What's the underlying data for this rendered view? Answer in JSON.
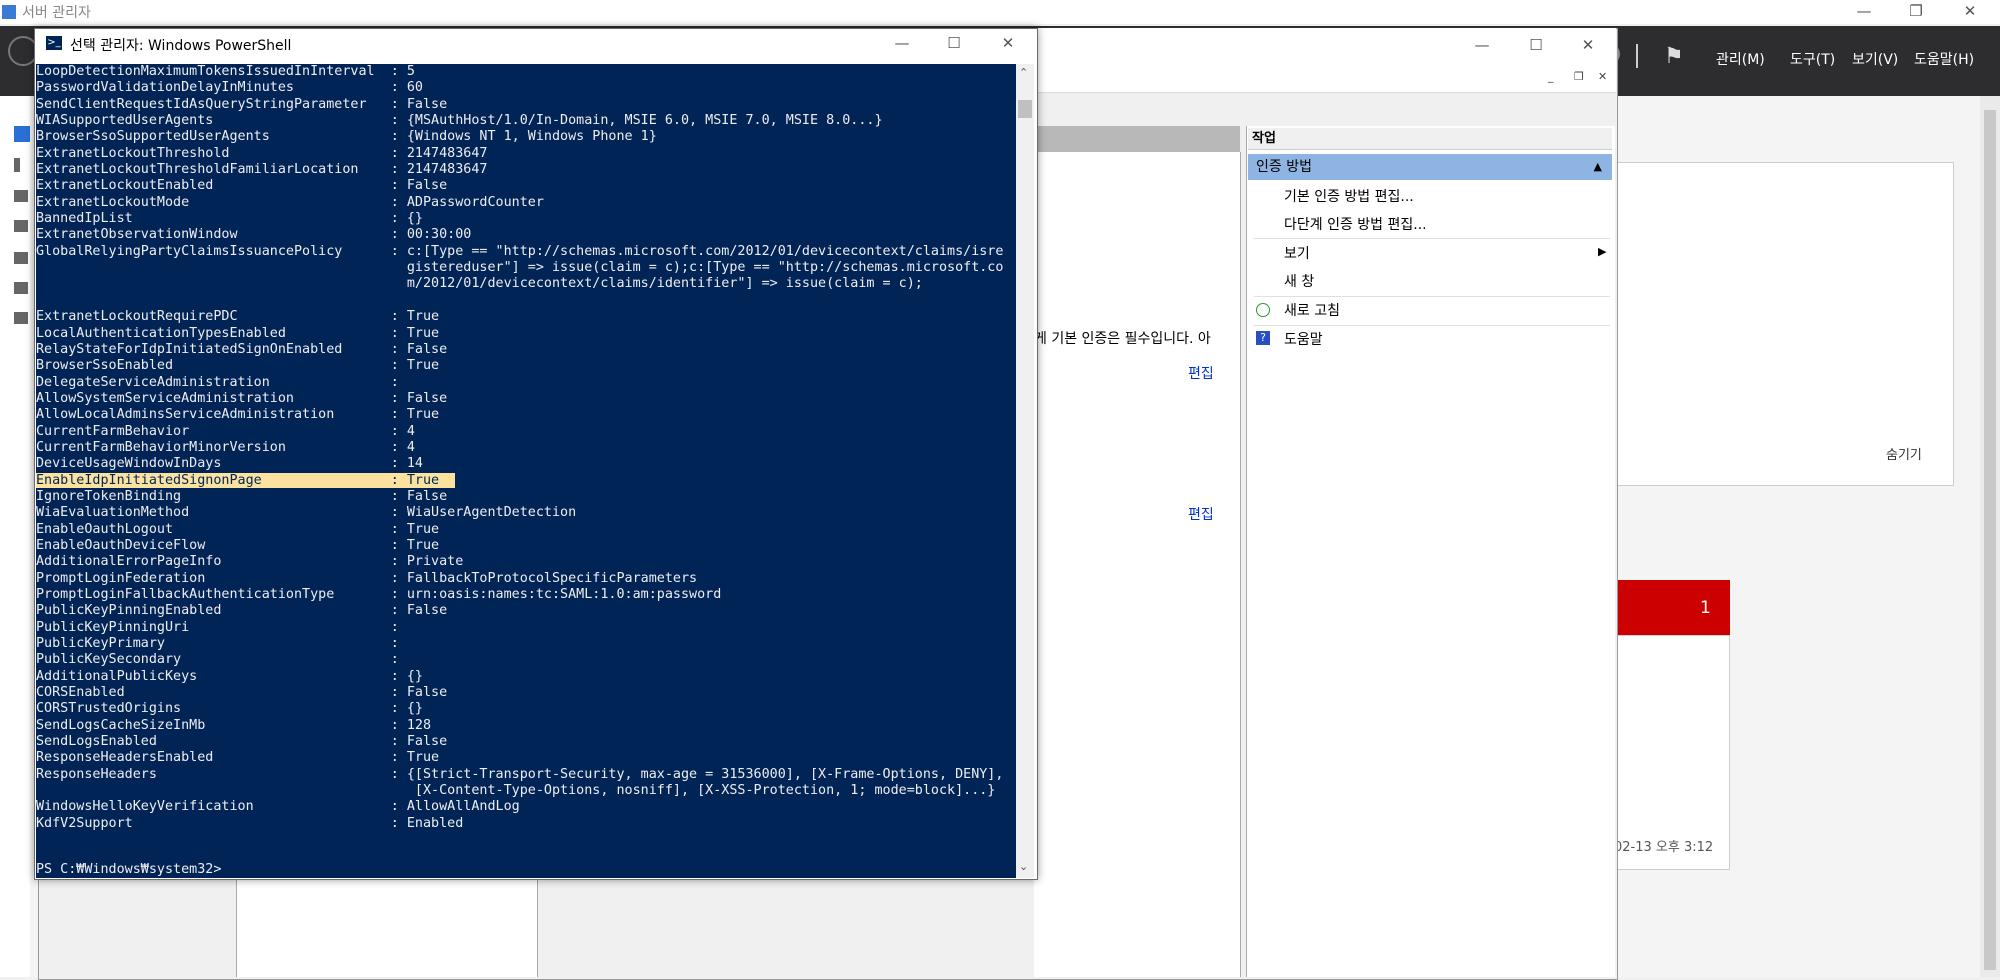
{
  "server_manager": {
    "title": "서버 관리자",
    "menu": [
      "관리(M)",
      "도구(T)",
      "보기(V)",
      "도움말(H)"
    ],
    "hide_label": "숨기기",
    "tile_count": "1",
    "tile_date": "02-13 오후 3:12"
  },
  "mmc": {
    "center_text": "게 기본 인증은 필수입니다. 아",
    "edit_label": "편집",
    "actions_title": "작업",
    "section_title": "인증 방법",
    "items": [
      "기본 인증 방법 편집...",
      "다단계 인증 방법 편집...",
      "보기",
      "새 창",
      "새로 고침",
      "도움말"
    ]
  },
  "powershell": {
    "title": "선택 관리자: Windows PowerShell",
    "prompt": "PS C:₩Windows₩system32>",
    "rows": [
      {
        "k": "LoopDetectionMaximumTokensIssuedInInterval",
        "v": "5"
      },
      {
        "k": "PasswordValidationDelayInMinutes",
        "v": "60"
      },
      {
        "k": "SendClientRequestIdAsQueryStringParameter",
        "v": "False"
      },
      {
        "k": "WIASupportedUserAgents",
        "v": "{MSAuthHost/1.0/In-Domain, MSIE 6.0, MSIE 7.0, MSIE 8.0...}"
      },
      {
        "k": "BrowserSsoSupportedUserAgents",
        "v": "{Windows NT 1, Windows Phone 1}"
      },
      {
        "k": "ExtranetLockoutThreshold",
        "v": "2147483647"
      },
      {
        "k": "ExtranetLockoutThresholdFamiliarLocation",
        "v": "2147483647"
      },
      {
        "k": "ExtranetLockoutEnabled",
        "v": "False"
      },
      {
        "k": "ExtranetLockoutMode",
        "v": "ADPasswordCounter"
      },
      {
        "k": "BannedIpList",
        "v": "{}"
      },
      {
        "k": "ExtranetObservationWindow",
        "v": "00:30:00"
      },
      {
        "k": "GlobalRelyingPartyClaimsIssuancePolicy",
        "v": "c:[Type == \"http://schemas.microsoft.com/2012/01/devicecontext/claims/isre"
      },
      {
        "k": "",
        "v": "gistereduser\"] => issue(claim = c);c:[Type == \"http://schemas.microsoft.co"
      },
      {
        "k": "",
        "v": "m/2012/01/devicecontext/claims/identifier\"] => issue(claim = c);"
      },
      {
        "k": "",
        "v": "",
        "blank": true
      },
      {
        "k": "ExtranetLockoutRequirePDC",
        "v": "True"
      },
      {
        "k": "LocalAuthenticationTypesEnabled",
        "v": "True"
      },
      {
        "k": "RelayStateForIdpInitiatedSignOnEnabled",
        "v": "False"
      },
      {
        "k": "BrowserSsoEnabled",
        "v": "True"
      },
      {
        "k": "DelegateServiceAdministration",
        "v": ""
      },
      {
        "k": "AllowSystemServiceAdministration",
        "v": "False"
      },
      {
        "k": "AllowLocalAdminsServiceAdministration",
        "v": "True"
      },
      {
        "k": "CurrentFarmBehavior",
        "v": "4"
      },
      {
        "k": "CurrentFarmBehaviorMinorVersion",
        "v": "4"
      },
      {
        "k": "DeviceUsageWindowInDays",
        "v": "14"
      },
      {
        "k": "EnableIdpInitiatedSignonPage",
        "v": "True",
        "selected": true
      },
      {
        "k": "IgnoreTokenBinding",
        "v": "False"
      },
      {
        "k": "WiaEvaluationMethod",
        "v": "WiaUserAgentDetection"
      },
      {
        "k": "EnableOauthLogout",
        "v": "True"
      },
      {
        "k": "EnableOauthDeviceFlow",
        "v": "True"
      },
      {
        "k": "AdditionalErrorPageInfo",
        "v": "Private"
      },
      {
        "k": "PromptLoginFederation",
        "v": "FallbackToProtocolSpecificParameters"
      },
      {
        "k": "PromptLoginFallbackAuthenticationType",
        "v": "urn:oasis:names:tc:SAML:1.0:am:password"
      },
      {
        "k": "PublicKeyPinningEnabled",
        "v": "False"
      },
      {
        "k": "PublicKeyPinningUri",
        "v": ""
      },
      {
        "k": "PublicKeyPrimary",
        "v": ""
      },
      {
        "k": "PublicKeySecondary",
        "v": ""
      },
      {
        "k": "AdditionalPublicKeys",
        "v": "{}"
      },
      {
        "k": "CORSEnabled",
        "v": "False"
      },
      {
        "k": "CORSTrustedOrigins",
        "v": "{}"
      },
      {
        "k": "SendLogsCacheSizeInMb",
        "v": "128"
      },
      {
        "k": "SendLogsEnabled",
        "v": "False"
      },
      {
        "k": "ResponseHeadersEnabled",
        "v": "True"
      },
      {
        "k": "ResponseHeaders",
        "v": "{[Strict-Transport-Security, max-age = 31536000], [X-Frame-Options, DENY],"
      },
      {
        "k": "",
        "v": " [X-Content-Type-Options, nosniff], [X-XSS-Protection, 1; mode=block]...}"
      },
      {
        "k": "WindowsHelloKeyVerification",
        "v": "AllowAllAndLog"
      },
      {
        "k": "KdfV2Support",
        "v": "Enabled"
      }
    ]
  }
}
